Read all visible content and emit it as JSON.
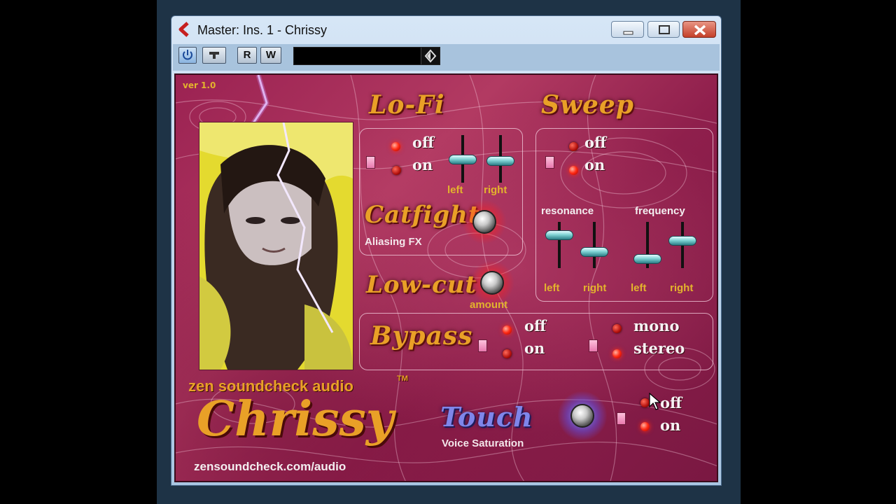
{
  "window": {
    "title": "Master: Ins. 1 - Chrissy",
    "toolbar": {
      "r_label": "R",
      "w_label": "W"
    }
  },
  "plugin": {
    "version": "ver 1.0",
    "lofi": {
      "title": "Lo-Fi",
      "off_label": "off",
      "on_label": "on",
      "left_label": "left",
      "right_label": "right",
      "state": "off"
    },
    "sweep": {
      "title": "Sweep",
      "off_label": "off",
      "on_label": "on",
      "state": "on",
      "resonance_label": "resonance",
      "frequency_label": "frequency",
      "left_label": "left",
      "right_label": "right"
    },
    "catfight": {
      "title": "Catfight",
      "subtitle": "Aliasing FX"
    },
    "lowcut": {
      "title": "Low-cut",
      "amount_label": "amount"
    },
    "bypass": {
      "title": "Bypass",
      "off_label": "off",
      "on_label": "on",
      "state": "off"
    },
    "output": {
      "mono_label": "mono",
      "stereo_label": "stereo",
      "state": "stereo"
    },
    "touch": {
      "title": "Touch",
      "subtitle": "Voice Saturation",
      "off_label": "off",
      "on_label": "on",
      "state": "on"
    },
    "brand": {
      "company": "zen soundcheck audio",
      "trademark": "TM",
      "product": "Chrissy",
      "url": "zensoundcheck.com/audio"
    }
  },
  "colors": {
    "plugin_bg": "#9b2252",
    "gold_text": "#e9a027",
    "led_red": "#ff2a14",
    "slider_cap": "#7fd3d4",
    "touch_title": "#7f86ea"
  }
}
